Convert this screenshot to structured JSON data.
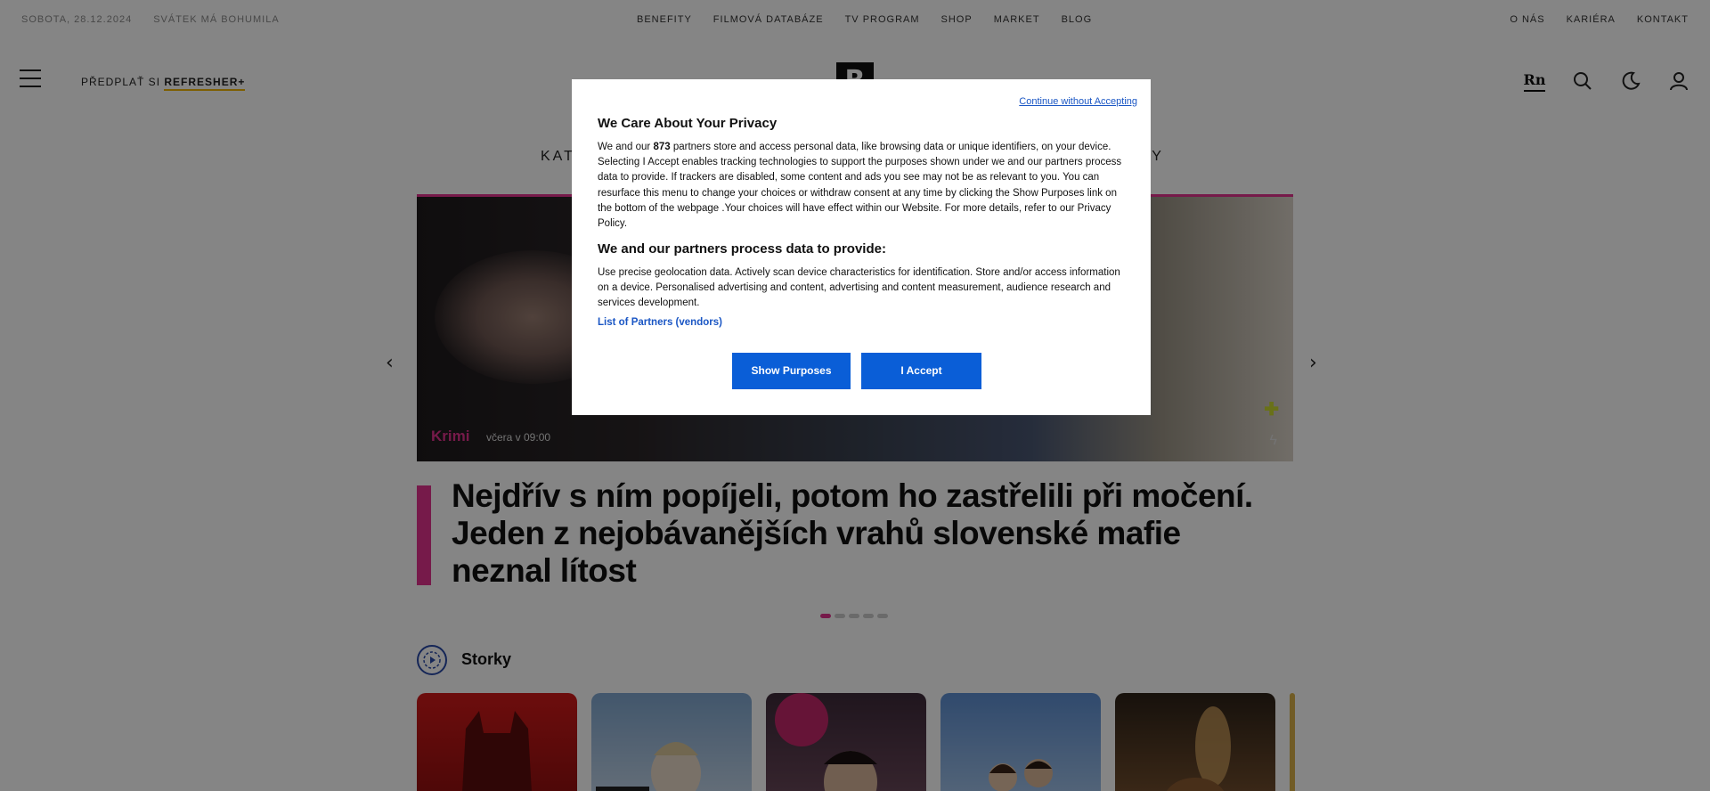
{
  "topbar": {
    "date": "Sobota, 28.12.2024",
    "nameday": "Svátek má Bohumila",
    "nav": [
      "Benefity",
      "Filmová databáze",
      "TV program",
      "Shop",
      "Market",
      "Blog"
    ],
    "right": [
      "O nás",
      "Kariéra",
      "Kontakt"
    ]
  },
  "header": {
    "subscribe_prefix": "Předplať si",
    "subscribe_brand": "Refresher+",
    "logo": "R",
    "rn_label": "Rn"
  },
  "catnav": {
    "left_fragment": "KAT",
    "right_fragment": "RY"
  },
  "hero": {
    "category": "Krimi",
    "time": "včera v 09:00",
    "headline": "Nejdřív s ním popíjeli, potom ho zastřelili při močení. Jeden z nejobávanějších vrahů slovenské mafie neznal lítost",
    "slide_count": 5,
    "active_slide": 1
  },
  "storky": {
    "title": "Storky"
  },
  "consent": {
    "continue_label": "Continue without Accepting",
    "title": "We Care About Your Privacy",
    "body_pre": "We and our ",
    "partner_count": "873",
    "body_post": " partners store and access personal data, like browsing data or unique identifiers, on your device. Selecting I Accept enables tracking technologies to support the purposes shown under we and our partners process data to provide. If trackers are disabled, some content and ads you see may not be as relevant to you. You can resurface this menu to change your choices or withdraw consent at any time by clicking the Show Purposes link on the bottom of the webpage .Your choices will have effect within our Website. For more details, refer to our Privacy Policy.",
    "subtitle": "We and our partners process data to provide:",
    "purposes": "Use precise geolocation data. Actively scan device characteristics for identification. Store and/or access information on a device. Personalised advertising and content, advertising and content measurement, audience research and services development.",
    "partners_link": "List of Partners (vendors)",
    "show_purposes": "Show Purposes",
    "accept": "I Accept"
  },
  "colors": {
    "accent": "#e2338e",
    "consent_button": "#0a5ed7",
    "link": "#1a56c4",
    "subscribe_underline": "#f2b705"
  }
}
